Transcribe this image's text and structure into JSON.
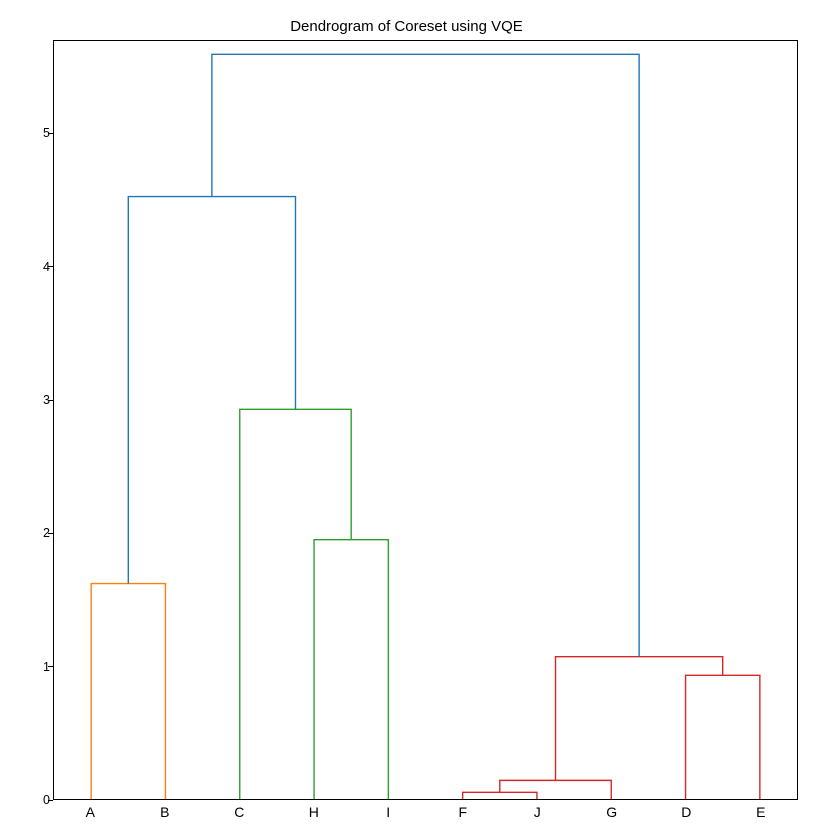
{
  "chart_data": {
    "type": "dendrogram",
    "title": "Dendrogram of Coreset using VQE",
    "xlabel": "",
    "ylabel": "",
    "ylim": [
      0,
      5.7
    ],
    "y_ticks": [
      0,
      1,
      2,
      3,
      4,
      5
    ],
    "x_leaf_labels": [
      "A",
      "B",
      "C",
      "H",
      "I",
      "F",
      "J",
      "G",
      "D",
      "E"
    ],
    "colors": {
      "blue": "#1f77b4",
      "orange": "#ff7f0e",
      "green": "#2ca02c",
      "red": "#d62728"
    },
    "links": [
      {
        "left_x": 0.05,
        "right_x": 0.15,
        "left_y": 0,
        "right_y": 0,
        "height": 1.62,
        "color": "orange"
      },
      {
        "left_x": 0.35,
        "right_x": 0.45,
        "left_y": 0,
        "right_y": 0,
        "height": 1.95,
        "color": "green"
      },
      {
        "left_x": 0.25,
        "right_x": 0.4,
        "left_y": 0,
        "right_y": 1.95,
        "height": 2.93,
        "color": "green"
      },
      {
        "left_x": 0.55,
        "right_x": 0.65,
        "left_y": 0,
        "right_y": 0,
        "height": 0.05,
        "color": "red"
      },
      {
        "left_x": 0.6,
        "right_x": 0.75,
        "left_y": 0.05,
        "right_y": 0,
        "height": 0.14,
        "color": "red"
      },
      {
        "left_x": 0.85,
        "right_x": 0.95,
        "left_y": 0,
        "right_y": 0,
        "height": 0.93,
        "color": "red"
      },
      {
        "left_x": 0.675,
        "right_x": 0.9,
        "left_y": 0.14,
        "right_y": 0.93,
        "height": 1.07,
        "color": "red"
      },
      {
        "left_x": 0.1,
        "right_x": 0.325,
        "left_y": 1.62,
        "right_y": 2.93,
        "height": 4.53,
        "color": "blue"
      },
      {
        "left_x": 0.2125,
        "right_x": 0.7875,
        "left_y": 4.53,
        "right_y": 1.07,
        "height": 5.6,
        "color": "blue"
      }
    ]
  }
}
